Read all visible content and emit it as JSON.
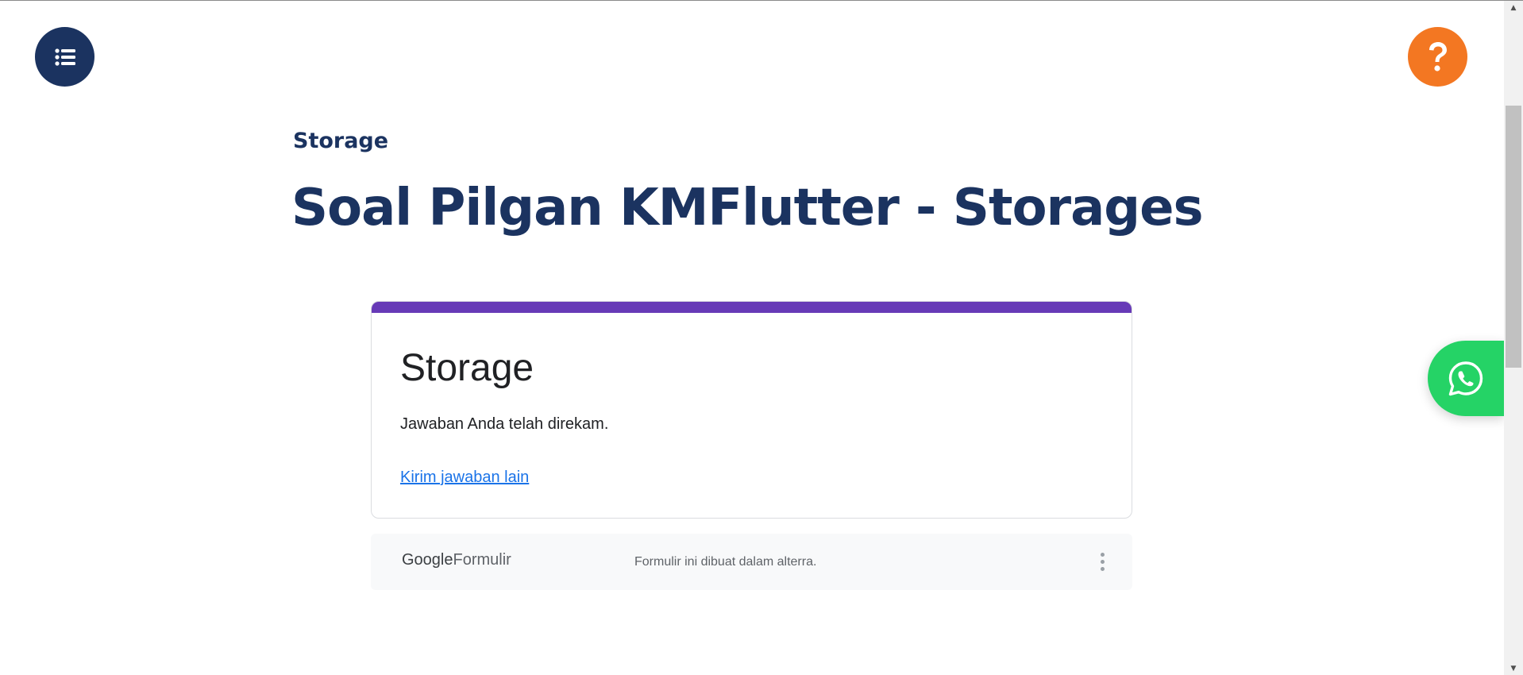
{
  "header": {
    "menu_button": {
      "icon": "list-icon",
      "color": "#1b3360"
    },
    "help_button": {
      "icon": "question-mark-icon",
      "color": "#f37722"
    }
  },
  "article": {
    "category": "Storage",
    "title": "Soal Pilgan KMFlutter - Storages"
  },
  "form": {
    "accent_color": "#673ab7",
    "title": "Storage",
    "message": "Jawaban Anda telah direkam.",
    "resubmit_link": "Kirim jawaban lain"
  },
  "form_footer": {
    "brand_google": "Google",
    "brand_product": "Formulir",
    "note": "Formulir ini dibuat dalam alterra.",
    "menu_icon": "more-vertical-icon"
  },
  "floating": {
    "whatsapp_button": {
      "icon": "whatsapp-icon",
      "color": "#25d366"
    }
  },
  "colors": {
    "heading": "#1b3360",
    "link": "#1a73e8"
  }
}
